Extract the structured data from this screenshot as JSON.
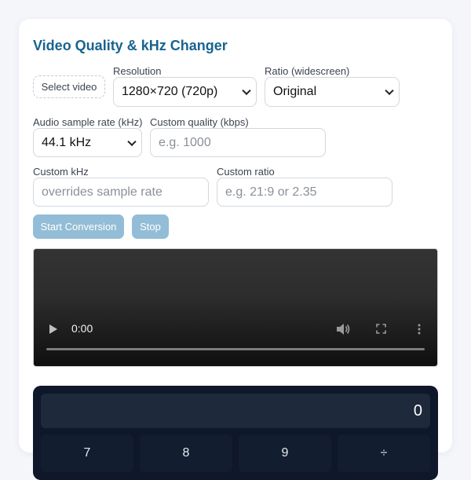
{
  "app": {
    "title": "Video Quality & kHz Changer",
    "accent_color": "#17648f"
  },
  "file_input": {
    "label": "Select video"
  },
  "resolution": {
    "label": "Resolution",
    "selected": "1280×720 (720p)"
  },
  "ratio": {
    "label": "Ratio (widescreen)",
    "selected": "Original"
  },
  "sample_rate": {
    "label": "Audio sample rate (kHz)",
    "selected": "44.1 kHz"
  },
  "custom_quality": {
    "label": "Custom quality (kbps)",
    "value": "",
    "placeholder": "e.g. 1000"
  },
  "custom_khz": {
    "label": "Custom kHz",
    "value": "",
    "placeholder": "overrides sample rate"
  },
  "custom_ratio": {
    "label": "Custom ratio",
    "value": "",
    "placeholder": "e.g. 21:9 or 2.35"
  },
  "actions": {
    "start_label": "Start Conversion",
    "stop_label": "Stop",
    "button_color": "#93bdd6"
  },
  "video_player": {
    "current_time": "0:00",
    "icons": [
      "play-icon",
      "volume-icon",
      "fullscreen-icon",
      "more-options-icon"
    ]
  },
  "calculator": {
    "display": "0",
    "keys": [
      "7",
      "8",
      "9",
      "÷"
    ],
    "background_color": "#0f172a"
  }
}
